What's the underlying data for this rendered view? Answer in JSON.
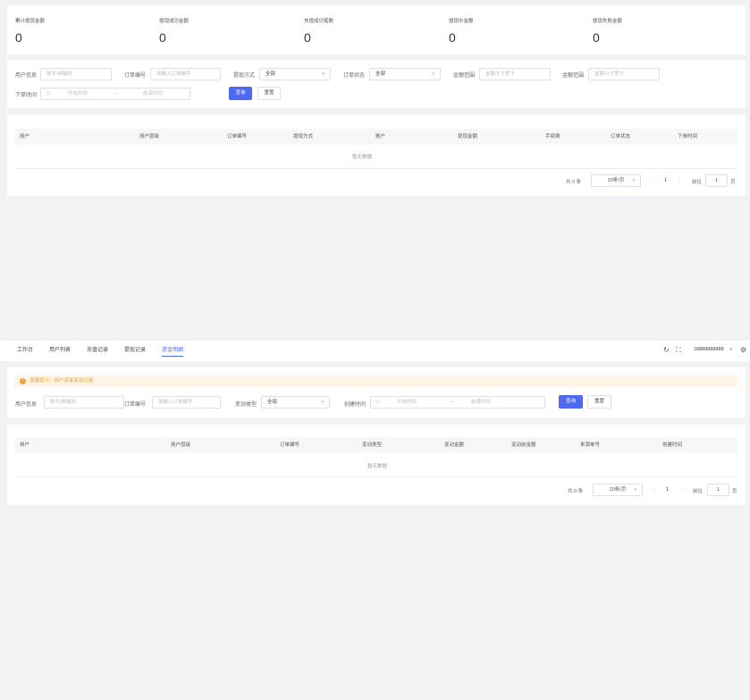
{
  "stats": [
    {
      "label": "累计提现金额",
      "value": "0"
    },
    {
      "label": "提现成功金额",
      "value": "0"
    },
    {
      "label": "充值成功笔数",
      "value": "0"
    },
    {
      "label": "提现中金额",
      "value": "0"
    },
    {
      "label": "提现失败金额",
      "value": "0"
    }
  ],
  "withdraw_filter": {
    "user_label": "用户信息",
    "user_placeholder": "账号/邮箱码",
    "order_label": "订单编号",
    "order_placeholder": "请输入订单编号",
    "method_label": "提现方式",
    "method_value": "全部",
    "status_label": "订单状态",
    "status_value": "全部",
    "amount_label_1": "金额范围",
    "amount_placeholder_1": "金额大于等于",
    "amount_label_2": "金额范围",
    "amount_placeholder_2": "金额小于等于",
    "time_label": "下单时间",
    "start_placeholder": "开始时间",
    "range_sep": "-",
    "end_placeholder": "结束时间",
    "query_btn": "查询",
    "reset_btn": "重置"
  },
  "withdraw_table": {
    "columns": [
      "用户",
      "用户层级",
      "订单编号",
      "提现方式",
      "账户",
      "提现金额",
      "手续费",
      "订单状态",
      "下单时间"
    ],
    "empty_text": "暂无数据"
  },
  "withdraw_pager": {
    "total": "共 0 条",
    "page_size": "20条/页",
    "prev": "‹",
    "current": "1",
    "next": "›",
    "goto_label": "前往",
    "goto_value": "1",
    "page_unit": "页"
  },
  "tabs": [
    {
      "label": "工作台",
      "active": false
    },
    {
      "label": "用户列表",
      "active": false
    },
    {
      "label": "充值记录",
      "active": false
    },
    {
      "label": "提现记录",
      "active": false
    },
    {
      "label": "资金明细",
      "active": true
    }
  ],
  "header": {
    "refresh_icon": "↻",
    "fullscreen_icon": "⛶",
    "account": "18888888888",
    "account_chevron": "∨",
    "settings_icon": "⚙"
  },
  "fund_notice": {
    "icon": "!",
    "text": "温馨提示：用户资金变动记录"
  },
  "fund_filter": {
    "user_label": "用户信息",
    "user_placeholder": "账号/邮箱码",
    "order_label": "订单编号",
    "order_placeholder": "请输入订单编号",
    "type_label": "变动类型",
    "type_value": "全部",
    "time_label": "创建时间",
    "start_placeholder": "开始时间",
    "range_sep": "-",
    "end_placeholder": "结束时间",
    "query_btn": "查询",
    "reset_btn": "重置"
  },
  "fund_table": {
    "columns": [
      "用户",
      "用户层级",
      "订单编号",
      "变动类型",
      "变动金额",
      "变动前金额",
      "来源单号",
      "创建时间"
    ],
    "empty_text": "暂无数据"
  },
  "fund_pager": {
    "total": "共 0 条",
    "page_size": "20条/页",
    "prev": "‹",
    "current": "1",
    "next": "›",
    "goto_label": "前往",
    "goto_value": "1",
    "page_unit": "页"
  },
  "colors": {
    "primary": "#4e68f0",
    "warning": "#e6a23c",
    "background": "#f2f2f4"
  }
}
